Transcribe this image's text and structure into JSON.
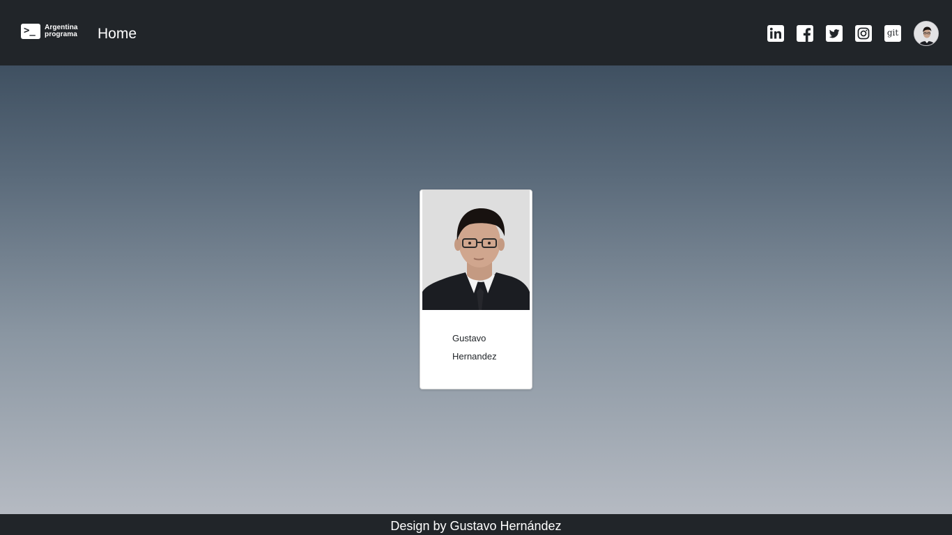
{
  "header": {
    "brand": {
      "line1": "Argentina",
      "line2": "programa",
      "prompt_glyph": ">_"
    },
    "nav_home": "Home",
    "social_links": [
      {
        "name": "linkedin",
        "icon": "linkedin-icon"
      },
      {
        "name": "facebook",
        "icon": "facebook-icon"
      },
      {
        "name": "twitter",
        "icon": "twitter-icon"
      },
      {
        "name": "instagram",
        "icon": "instagram-icon"
      },
      {
        "name": "github",
        "icon": "git-icon",
        "label": "git"
      }
    ],
    "avatar": "profile-avatar"
  },
  "profile_card": {
    "first_name": "Gustavo",
    "last_name": "Hernandez",
    "photo": "profile-photo"
  },
  "footer": {
    "text": "Design by Gustavo Hernández"
  },
  "colors": {
    "navbar": "#212529",
    "gradient_top": "#3f5061",
    "gradient_bottom": "#b5bac2",
    "card": "#ffffff"
  }
}
